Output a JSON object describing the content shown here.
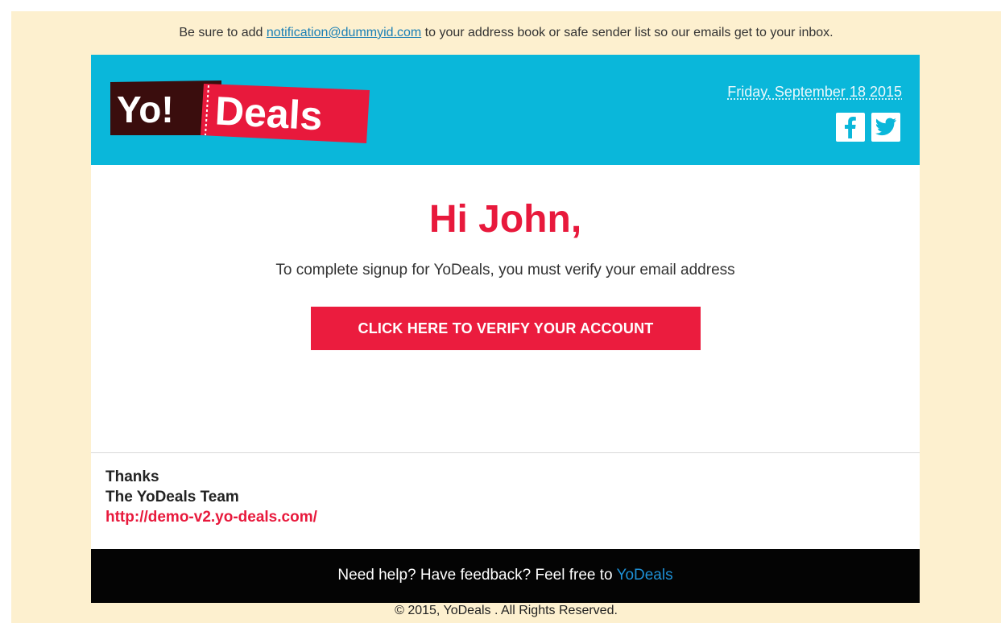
{
  "notice": {
    "prefix": "Be sure to add",
    "email": "notification@dummyid.com",
    "suffix": "to your address book or safe sender list so our emails get to your inbox."
  },
  "header": {
    "logo_left": "Yo!",
    "logo_right": "Deals",
    "date": "Friday, September 18 2015",
    "social": [
      "facebook-icon",
      "twitter-icon"
    ],
    "bg_color": "#0ab7da"
  },
  "body": {
    "greeting": "Hi John,",
    "intro": "To complete signup for YoDeals, you must verify your email address",
    "verify_label": "CLICK HERE TO VERIFY YOUR ACCOUNT",
    "accent_color": "#eb1c3e"
  },
  "signoff": {
    "thanks": "Thanks",
    "team": "The YoDeals Team",
    "url": "http://demo-v2.yo-deals.com/"
  },
  "footer": {
    "help_text": "Need help? Have feedback? Feel free to",
    "help_link": "YoDeals",
    "copyright": "© 2015, YoDeals . All Rights Reserved."
  }
}
